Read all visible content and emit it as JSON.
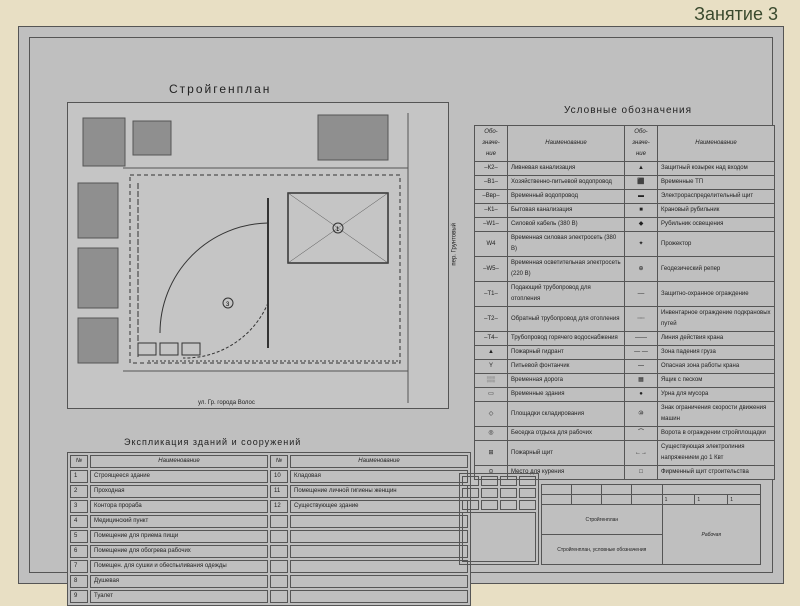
{
  "header": {
    "lesson_label": "Занятие 3"
  },
  "plan": {
    "title": "Стройгенплан",
    "street_bottom": "ул. Гр. города Волос",
    "street_right": "пер. Грунтовый"
  },
  "explication": {
    "title": "Экспликация зданий и сооружений",
    "col_header": "Наименование",
    "rows_left": [
      {
        "n": "1",
        "name": "Строящееся здание"
      },
      {
        "n": "2",
        "name": "Проходная"
      },
      {
        "n": "3",
        "name": "Контора прораба"
      },
      {
        "n": "4",
        "name": "Медицинский пункт"
      },
      {
        "n": "5",
        "name": "Помещение для приема пищи"
      },
      {
        "n": "6",
        "name": "Помещение для обогрева рабочих"
      },
      {
        "n": "7",
        "name": "Помещен. для сушки и обеспыливания одежды"
      },
      {
        "n": "8",
        "name": "Душевая"
      },
      {
        "n": "9",
        "name": "Туалет"
      }
    ],
    "rows_right": [
      {
        "n": "10",
        "name": "Кладовая"
      },
      {
        "n": "11",
        "name": "Помещение личной гигиены женщин"
      },
      {
        "n": "12",
        "name": "Существующее здание"
      }
    ]
  },
  "legend": {
    "title": "Условные обозначения",
    "sym_header": "Обо-\nзначе-\nние",
    "name_header": "Наименование",
    "left": [
      {
        "s": "–К2–",
        "name": "Ливневая канализация"
      },
      {
        "s": "–В1–",
        "name": "Хозяйственно-питьевой водопровод"
      },
      {
        "s": "–Ввр–",
        "name": "Временный водопровод"
      },
      {
        "s": "–К1–",
        "name": "Бытовая канализация"
      },
      {
        "s": "–W1–",
        "name": "Силовой кабель (380 В)"
      },
      {
        "s": "W4",
        "name": "Временная силовая электросеть (380 В)"
      },
      {
        "s": "–W5–",
        "name": "Временная осветительная электросеть (220 В)"
      },
      {
        "s": "–Т1–",
        "name": "Подающий трубопровод для отопления"
      },
      {
        "s": "–Т2–",
        "name": "Обратный трубопровод для отопления"
      },
      {
        "s": "–Т4–",
        "name": "Трубопровод горячего водоснабжения"
      },
      {
        "s": "▲",
        "name": "Пожарный гидрант"
      },
      {
        "s": "Y",
        "name": "Питьевой фонтанчик"
      },
      {
        "s": "░░",
        "name": "Временная дорога"
      },
      {
        "s": "▭",
        "name": "Временные здания"
      },
      {
        "s": "◇",
        "name": "Площадки складирования"
      },
      {
        "s": "◎",
        "name": "Беседка отдыха для рабочих"
      },
      {
        "s": "⊞",
        "name": "Пожарный щит"
      },
      {
        "s": "⊙",
        "name": "Место для курения"
      }
    ],
    "right": [
      {
        "s": "▲",
        "name": "Защитный козырек над входом"
      },
      {
        "s": "⬛",
        "name": "Временные ТП"
      },
      {
        "s": "▬",
        "name": "Электрораспределительный щит"
      },
      {
        "s": "■",
        "name": "Крановый рубильник"
      },
      {
        "s": "◆",
        "name": "Рубильник освещения"
      },
      {
        "s": "✦",
        "name": "Прожектор"
      },
      {
        "s": "⊕",
        "name": "Геодезический репер"
      },
      {
        "s": "––",
        "name": "Защитно-охранное ограждение"
      },
      {
        "s": "┄┄",
        "name": "Инвентарное ограждение подкрановых путей"
      },
      {
        "s": "——",
        "name": "Линия действия крана"
      },
      {
        "s": "— —",
        "name": "Зона падения груза"
      },
      {
        "s": "⎯⎯",
        "name": "Опасная зона работы крана"
      },
      {
        "s": "▦",
        "name": "Ящик с песком"
      },
      {
        "s": "●",
        "name": "Урна для мусора"
      },
      {
        "s": "⑩",
        "name": "Знак ограничения скорости движения машин"
      },
      {
        "s": "⌒",
        "name": "Ворота в ограждении стройплощадки"
      },
      {
        "s": "←→",
        "name": "Существующая электролиния напряжением до 1 Квт"
      },
      {
        "s": "□",
        "name": "Фирменный щит строительства"
      }
    ]
  },
  "stamp": {
    "project": "Стройгенплан",
    "sheet": "Стройгенплан, условные обозначения",
    "right_label": "Рабочая",
    "cells": {
      "stage": "1",
      "sheet_no": "1",
      "total": "1"
    }
  }
}
